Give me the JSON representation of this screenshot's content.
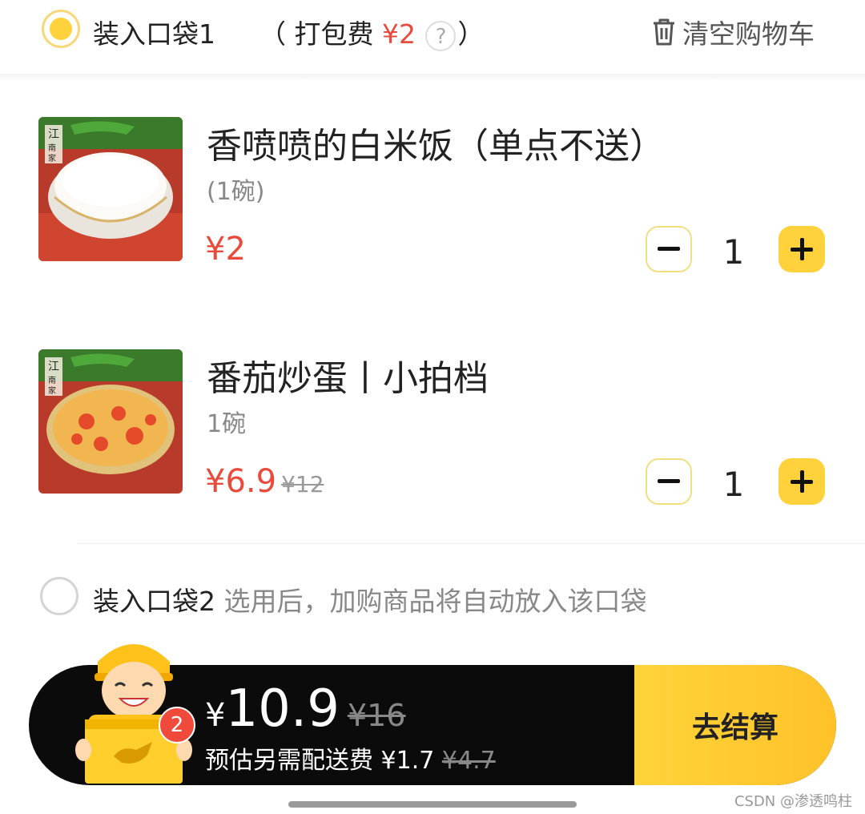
{
  "bag1": {
    "label": "装入口袋1",
    "fee_prefix": "（ 打包费 ",
    "fee_value": "¥2",
    "help": "?",
    "fee_suffix": "）"
  },
  "clear_cart": "清空购物车",
  "items": [
    {
      "name": "香喷喷的白米饭（单点不送）",
      "spec": "(1碗)",
      "price": "¥2",
      "original_price": "",
      "quantity": "1"
    },
    {
      "name": "番茄炒蛋丨小拍档",
      "spec": "1碗",
      "price": "¥6.9",
      "original_price": "¥12",
      "quantity": "1"
    }
  ],
  "bag2": {
    "label": "装入口袋2",
    "hint": "选用后，加购商品将自动放入该口袋"
  },
  "checkout_bar": {
    "currency": "¥",
    "total": "10.9",
    "original_total": "¥16",
    "delivery_fee_label": "预估另需配送费",
    "delivery_fee": "¥1.7",
    "original_delivery_fee": "¥4.7",
    "item_count": "2",
    "checkout_label": "去结算"
  },
  "watermark": "CSDN @渗透鸣柱",
  "colors": {
    "accent": "#ffd23c",
    "price": "#e84a3b",
    "bar": "#0b0b0b"
  }
}
